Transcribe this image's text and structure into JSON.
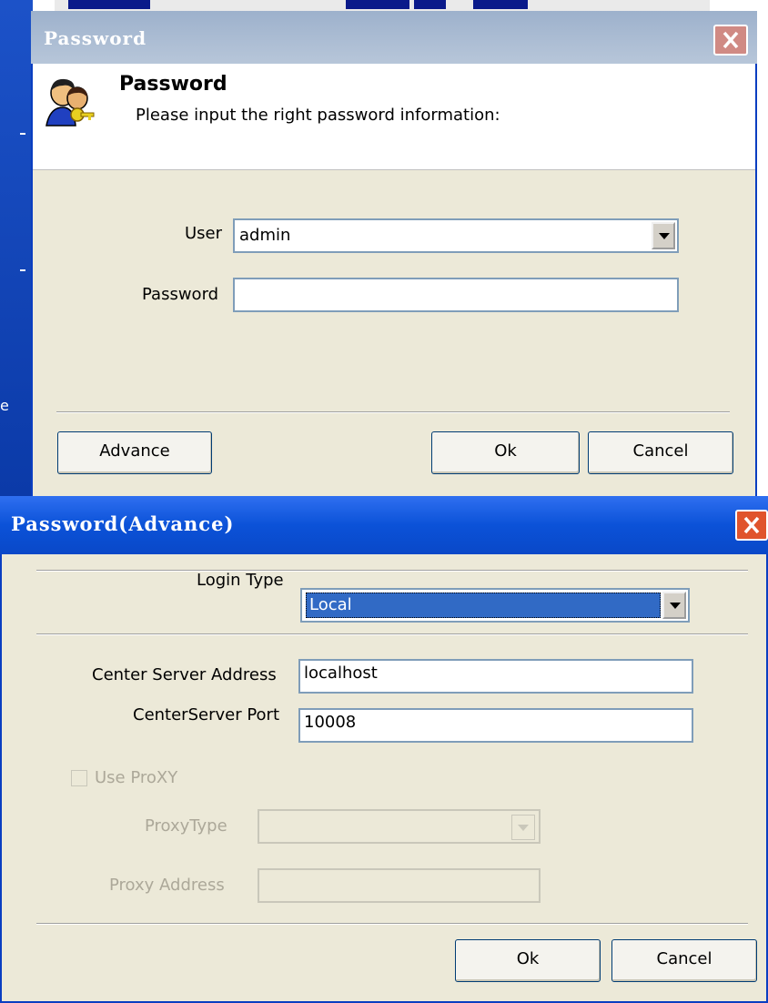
{
  "background": {
    "left_text": "e"
  },
  "dialog1": {
    "title": "Password",
    "close_icon": "close-icon",
    "header": {
      "icon": "users-key-icon",
      "title": "Password",
      "subtitle": "Please input the right password information:"
    },
    "user_label": "User",
    "user_value": "admin",
    "password_label": "Password",
    "password_value": "",
    "buttons": {
      "advance": "Advance",
      "ok": "Ok",
      "cancel": "Cancel"
    }
  },
  "dialog2": {
    "title": "Password(Advance)",
    "close_icon": "close-icon",
    "login_type_label": "Login Type",
    "login_type_value": "Local",
    "center_server_address_label": "Center Server Address",
    "center_server_address_value": "localhost",
    "center_server_port_label": "CenterServer Port",
    "center_server_port_value": "10008",
    "use_proxy_label": "Use ProXY",
    "proxy_type_label": "ProxyType",
    "proxy_type_value": "",
    "proxy_address_label": "Proxy Address",
    "proxy_address_value": "",
    "buttons": {
      "ok": "Ok",
      "cancel": "Cancel"
    }
  },
  "colors": {
    "title_active": "#0b52d8",
    "title_inactive": "#9db1cc",
    "dialog_bg": "#ece9d8",
    "selection": "#316ac5"
  }
}
